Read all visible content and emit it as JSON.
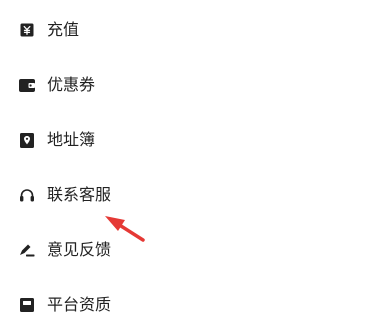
{
  "menu": {
    "items": [
      {
        "label": "充值",
        "icon": "recharge-icon"
      },
      {
        "label": "优惠券",
        "icon": "wallet-icon"
      },
      {
        "label": "地址簿",
        "icon": "location-pin-icon"
      },
      {
        "label": "联系客服",
        "icon": "headset-icon"
      },
      {
        "label": "意见反馈",
        "icon": "pen-icon"
      },
      {
        "label": "平台资质",
        "icon": "certificate-icon"
      }
    ]
  },
  "annotation": {
    "arrow_color": "#e53935"
  },
  "colors": {
    "text": "#222222",
    "icon": "#222222",
    "background": "#ffffff"
  }
}
